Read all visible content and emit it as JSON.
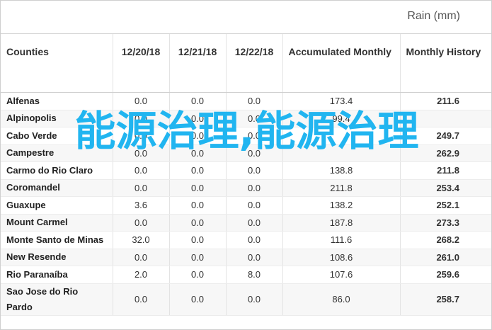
{
  "title": "Rain (mm)",
  "columns": [
    "Counties",
    "12/20/18",
    "12/21/18",
    "12/22/18",
    "Accumulated Monthly",
    "Monthly History"
  ],
  "rows": [
    {
      "county": "Alfenas",
      "d1": "0.0",
      "d2": "0.0",
      "d3": "0.0",
      "acc": "173.4",
      "hist": "211.6"
    },
    {
      "county": "Alpinopolis",
      "d1": "0.0",
      "d2": "0.0",
      "d3": "0.0",
      "acc": "99.4",
      "hist": ""
    },
    {
      "county": "Cabo Verde",
      "d1": "0.0",
      "d2": "0.0",
      "d3": "0.0",
      "acc": "",
      "hist": "249.7"
    },
    {
      "county": "Campestre",
      "d1": "0.0",
      "d2": "0.0",
      "d3": "0.0",
      "acc": "",
      "hist": "262.9"
    },
    {
      "county": "Carmo do Rio Claro",
      "d1": "0.0",
      "d2": "0.0",
      "d3": "0.0",
      "acc": "138.8",
      "hist": "211.8"
    },
    {
      "county": "Coromandel",
      "d1": "0.0",
      "d2": "0.0",
      "d3": "0.0",
      "acc": "211.8",
      "hist": "253.4"
    },
    {
      "county": "Guaxupe",
      "d1": "3.6",
      "d2": "0.0",
      "d3": "0.0",
      "acc": "138.2",
      "hist": "252.1"
    },
    {
      "county": "Mount Carmel",
      "d1": "0.0",
      "d2": "0.0",
      "d3": "0.0",
      "acc": "187.8",
      "hist": "273.3"
    },
    {
      "county": "Monte Santo de Minas",
      "d1": "32.0",
      "d2": "0.0",
      "d3": "0.0",
      "acc": "111.6",
      "hist": "268.2"
    },
    {
      "county": "New Resende",
      "d1": "0.0",
      "d2": "0.0",
      "d3": "0.0",
      "acc": "108.6",
      "hist": "261.0"
    },
    {
      "county": "Rio Paranaíba",
      "d1": "2.0",
      "d2": "0.0",
      "d3": "8.0",
      "acc": "107.6",
      "hist": "259.6"
    },
    {
      "county": "Sao Jose do Rio Pardo",
      "d1": "0.0",
      "d2": "0.0",
      "d3": "0.0",
      "acc": "86.0",
      "hist": "258.7"
    }
  ],
  "overlay_text": "能源治理,能源治理",
  "colors": {
    "overlay": "#21b5f0",
    "border": "#cfcfcf",
    "zebra": "#f7f7f7"
  }
}
